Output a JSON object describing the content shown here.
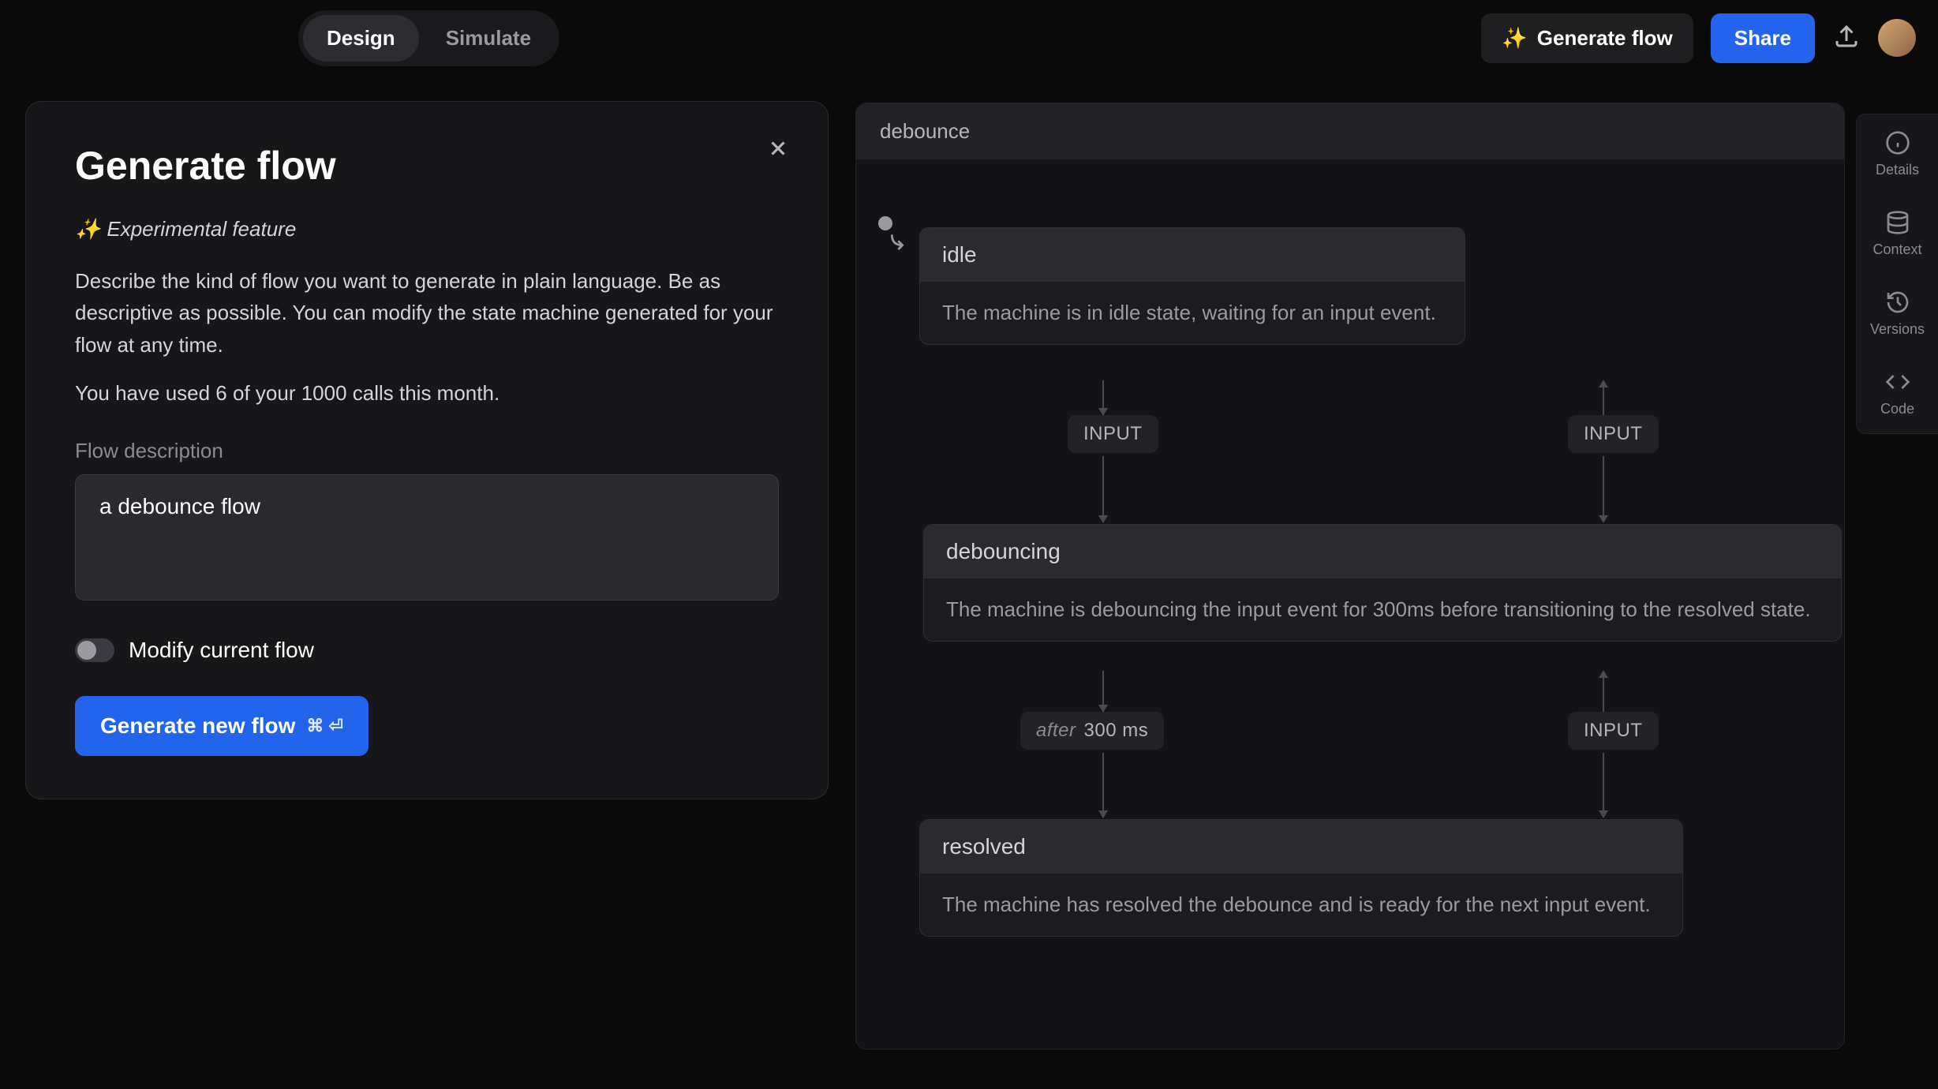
{
  "topbar": {
    "tabs": {
      "design": "Design",
      "simulate": "Simulate"
    },
    "generate_flow": "Generate flow",
    "share": "Share"
  },
  "modal": {
    "title": "Generate flow",
    "feature_tag": "Experimental feature",
    "description": "Describe the kind of flow you want to generate in plain language. Be as descriptive as possible. You can modify the state machine generated for your flow at any time.",
    "usage": "You have used 6 of your 1000 calls this month.",
    "field_label": "Flow description",
    "textarea_value": "a debounce flow",
    "toggle_label": "Modify current flow",
    "button_label": "Generate new flow",
    "shortcut": "⌘ ⏎"
  },
  "canvas": {
    "title": "debounce",
    "states": {
      "idle": {
        "name": "idle",
        "desc": "The machine is in idle state, waiting for an input event."
      },
      "debouncing": {
        "name": "debouncing",
        "desc": "The machine is debouncing the input event for 300ms before transitioning to the resolved state."
      },
      "resolved": {
        "name": "resolved",
        "desc": "The machine has resolved the debounce and is ready for the next input event."
      }
    },
    "transitions": {
      "input": "INPUT",
      "after_kw": "after",
      "after_val": "300 ms"
    }
  },
  "sidebar": {
    "details": "Details",
    "context": "Context",
    "versions": "Versions",
    "code": "Code"
  }
}
